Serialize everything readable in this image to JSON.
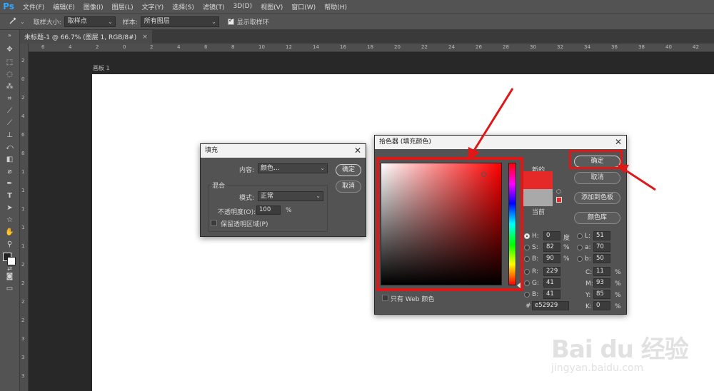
{
  "app": {
    "logo": "Ps"
  },
  "menubar": {
    "items": [
      "文件(F)",
      "编辑(E)",
      "图像(I)",
      "图层(L)",
      "文字(Y)",
      "选择(S)",
      "滤镜(T)",
      "3D(D)",
      "视图(V)",
      "窗口(W)",
      "帮助(H)"
    ]
  },
  "optionsbar": {
    "tool_icon": "eyedropper-icon",
    "sample_size_label": "取样大小:",
    "sample_size_value": "取样点",
    "sample_label": "样本:",
    "sample_value": "所有图层",
    "show_ring_label": "显示取样环",
    "show_ring_checked": true
  },
  "document_tab": {
    "title": "未标题-1 @ 66.7% (图层 1, RGB/8#)",
    "close": "×"
  },
  "artboard": {
    "label": "画板 1"
  },
  "rulers": {
    "top": [
      "6",
      "4",
      "2",
      "0",
      "2",
      "4",
      "6",
      "8",
      "10",
      "12",
      "14",
      "16",
      "18",
      "20",
      "22",
      "24",
      "26",
      "28",
      "30",
      "32",
      "34",
      "36",
      "38",
      "40",
      "42"
    ],
    "left": [
      "2",
      "0",
      "2",
      "4",
      "6",
      "8",
      "1",
      "1",
      "1",
      "1",
      "1",
      "2",
      "2",
      "2",
      "2",
      "3",
      "3",
      "3"
    ]
  },
  "fill_dialog": {
    "title": "填充",
    "close": "✕",
    "content_label": "内容:",
    "content_value": "颜色...",
    "ok": "确定",
    "cancel": "取消",
    "blend_group": "混合",
    "mode_label": "模式:",
    "mode_value": "正常",
    "opacity_label": "不透明度(O):",
    "opacity_value": "100",
    "opacity_unit": "%",
    "preserve_label": "保留透明区域(P)"
  },
  "color_picker": {
    "title": "拾色器 (填充颜色)",
    "close": "✕",
    "new_label": "新的",
    "current_label": "当前",
    "ok": "确定",
    "cancel": "取消",
    "add_swatch": "添加到色板",
    "color_libraries": "颜色库",
    "web_only_label": "只有 Web 颜色",
    "hsb": [
      {
        "label": "H:",
        "value": "0",
        "unit": "度",
        "selected": true
      },
      {
        "label": "S:",
        "value": "82",
        "unit": "%",
        "selected": false
      },
      {
        "label": "B:",
        "value": "90",
        "unit": "%",
        "selected": false
      }
    ],
    "rgb": [
      {
        "label": "R:",
        "value": "229"
      },
      {
        "label": "G:",
        "value": "41"
      },
      {
        "label": "B:",
        "value": "41"
      }
    ],
    "lab": [
      {
        "label": "L:",
        "value": "51"
      },
      {
        "label": "a:",
        "value": "70"
      },
      {
        "label": "b:",
        "value": "50"
      }
    ],
    "cmyk": [
      {
        "label": "C:",
        "value": "11",
        "unit": "%"
      },
      {
        "label": "M:",
        "value": "93",
        "unit": "%"
      },
      {
        "label": "Y:",
        "value": "85",
        "unit": "%"
      },
      {
        "label": "K:",
        "value": "0",
        "unit": "%"
      }
    ],
    "hex_label": "#",
    "hex_value": "e52929",
    "new_color": "#e52929",
    "current_color": "#a9a9a9"
  },
  "annotation_color": "#e01717",
  "watermark": {
    "main": "Bai du 经验",
    "sub": "jingyan.baidu.com"
  }
}
